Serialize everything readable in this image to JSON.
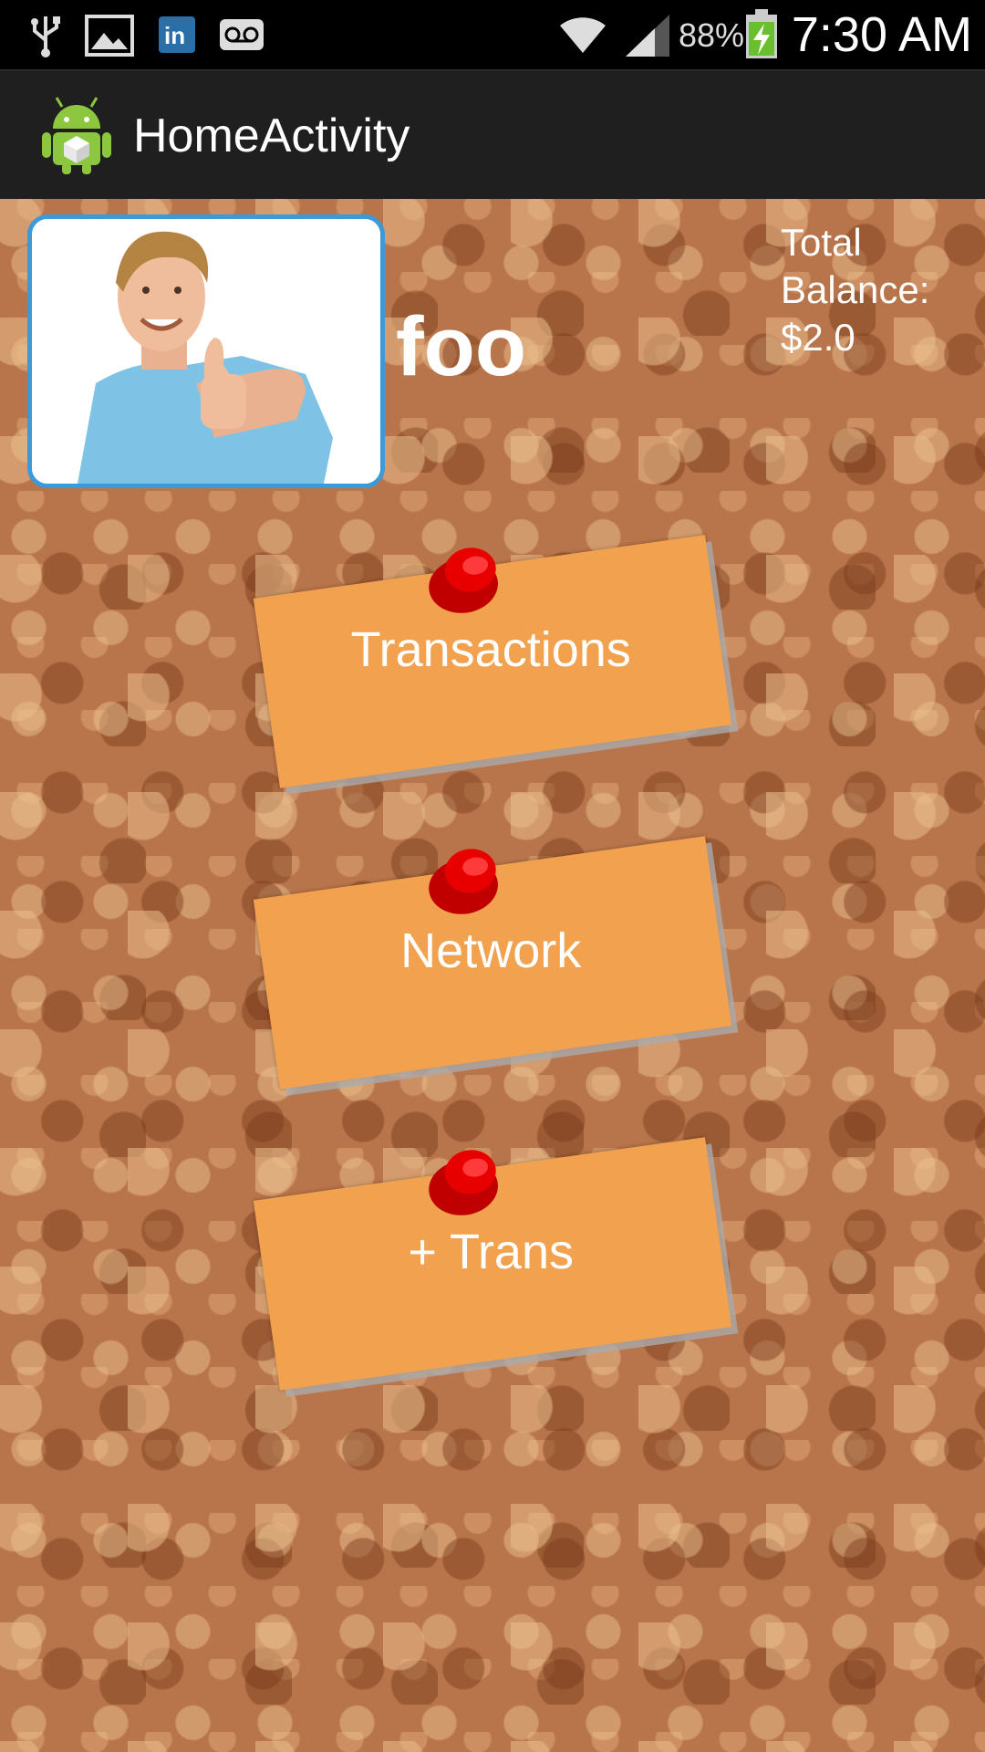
{
  "status_bar": {
    "icons": [
      "usb-icon",
      "image-icon",
      "linkedin-icon",
      "voicemail-icon",
      "wifi-icon",
      "signal-icon",
      "battery-charging-icon"
    ],
    "battery_percent": "88%",
    "time": "7:30 AM"
  },
  "action_bar": {
    "title": "HomeActivity",
    "icon": "android-app-icon"
  },
  "profile": {
    "name": "foo",
    "photo": "profile-photo"
  },
  "balance": {
    "line1": "Total",
    "line2": "Balance:",
    "line3": "$2.0"
  },
  "notes": [
    {
      "label": "Transactions"
    },
    {
      "label": "Network"
    },
    {
      "label": "+ Trans"
    }
  ],
  "colors": {
    "note": "#f2a14f",
    "pin": "#e00000",
    "photo_border": "#3b9ad9",
    "action_bar": "#1f1f1f",
    "cork": "#b8744a"
  }
}
